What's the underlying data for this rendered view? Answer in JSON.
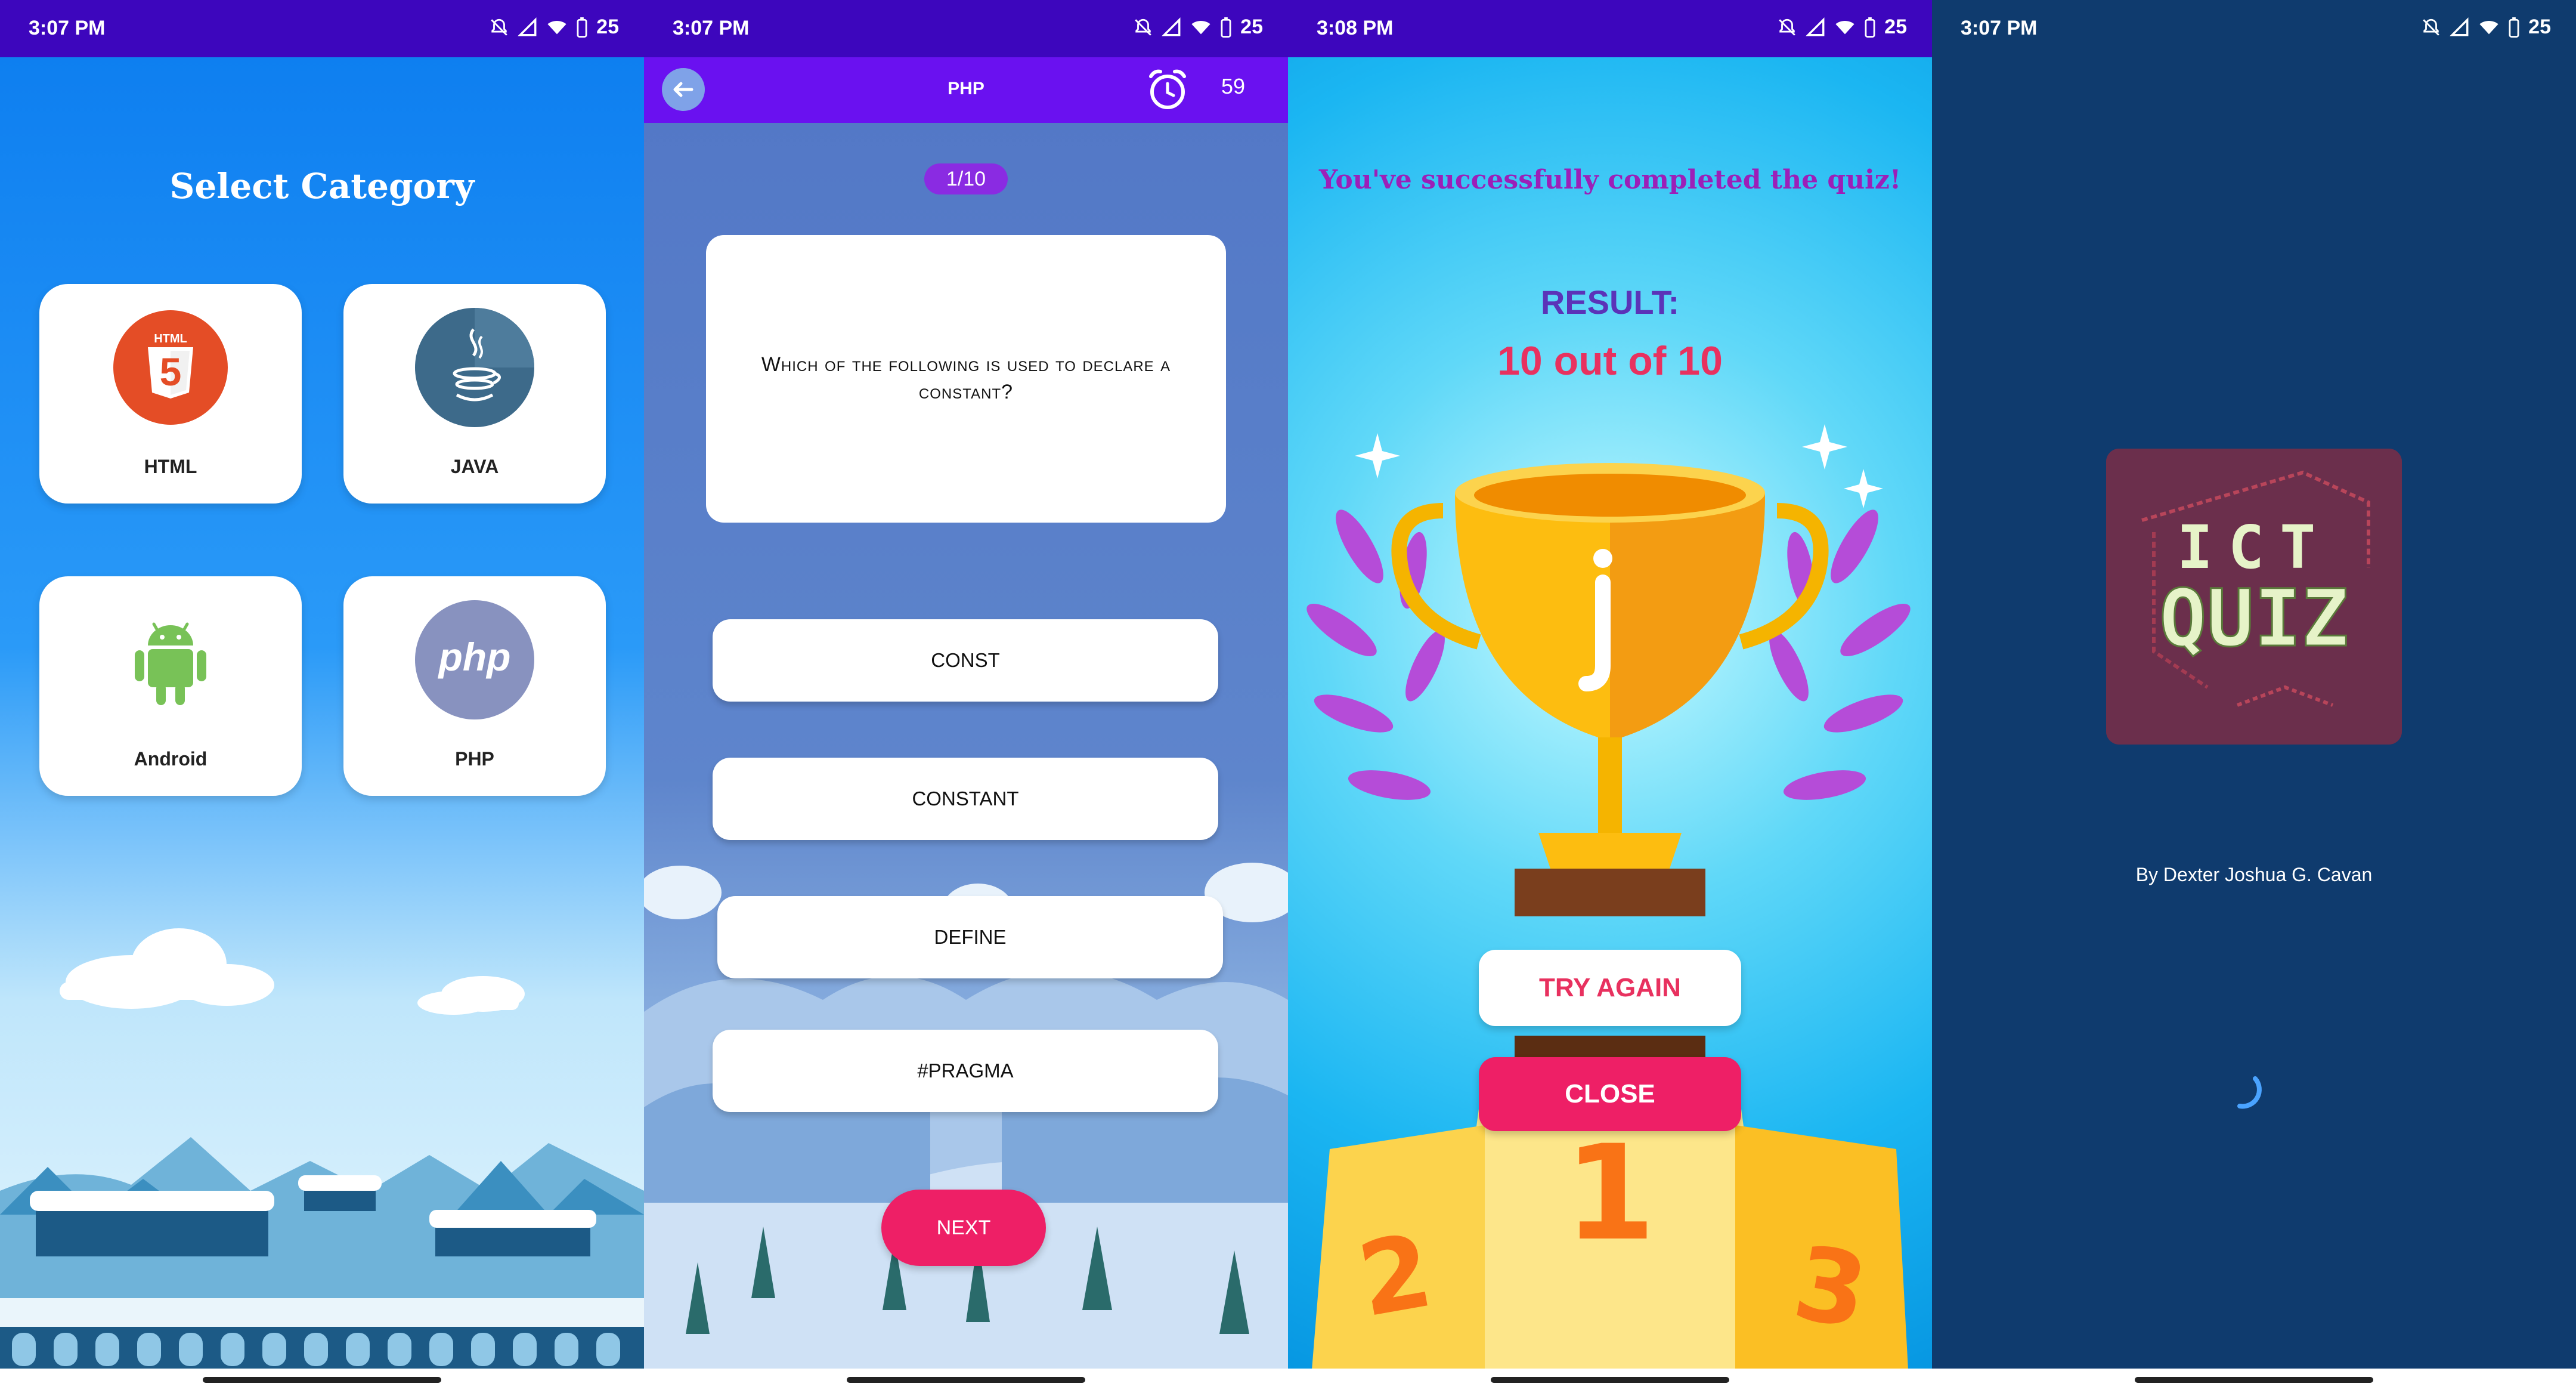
{
  "status_bars": [
    {
      "time": "3:07 PM",
      "battery": "25"
    },
    {
      "time": "3:07 PM",
      "battery": "25"
    },
    {
      "time": "3:08 PM",
      "battery": "25"
    },
    {
      "time": "3:07 PM",
      "battery": "25"
    }
  ],
  "category_screen": {
    "title": "Select Category",
    "categories": [
      {
        "label": "HTML",
        "icon": "html5-icon",
        "color": "#e44d26"
      },
      {
        "label": "JAVA",
        "icon": "java-icon",
        "color": "#3d6a8a"
      },
      {
        "label": "Android",
        "icon": "android-icon",
        "color": "#78c257"
      },
      {
        "label": "PHP",
        "icon": "php-icon",
        "color": "#8892bf"
      }
    ]
  },
  "quiz_screen": {
    "title": "PHP",
    "timer": "59",
    "progress": "1/10",
    "question": "Which of the following is used to declare a constant?",
    "options": [
      "CONST",
      "CONSTANT",
      "DEFINE",
      "#PRAGMA"
    ],
    "next_label": "NEXT"
  },
  "result_screen": {
    "message": "You've successfully completed the quiz!",
    "result_label": "RESULT:",
    "score_text": "10 out of 10",
    "try_again_label": "TRY AGAIN",
    "close_label": "CLOSE"
  },
  "splash_screen": {
    "logo_line1": "ICT",
    "logo_line2": "QUIZ",
    "credit": "By Dexter Joshua G. Cavan"
  },
  "colors": {
    "status_bar": "#3d06bd",
    "quiz_app_bar": "#6a11f0",
    "accent_pink": "#ee1f66",
    "score_red": "#e8315f",
    "splash_bg": "#0f3b6e"
  }
}
